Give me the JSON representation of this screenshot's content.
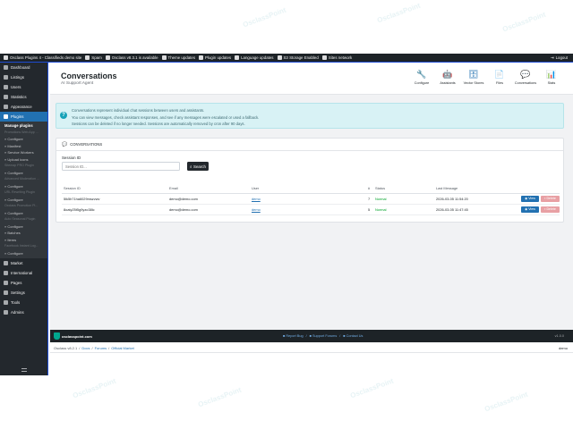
{
  "topbar": {
    "items": [
      "Osclass Plugins 4 - Classifieds demo site",
      "Spam",
      "Osclass v8.3.1 is available",
      "Theme updates",
      "Plugin updates",
      "Language updates",
      "S3 Storage Enabled",
      "Sites network"
    ],
    "logout": "Logout"
  },
  "sidebar": {
    "items_top": [
      "Dashboard",
      "Listings",
      "Users",
      "Statistics",
      "Appearance"
    ],
    "plugins": "Plugins",
    "sub": [
      {
        "t": "Manage plugins",
        "c": "head"
      },
      {
        "t": "Promotions Web App ...",
        "c": "grey"
      },
      {
        "t": "» Configure",
        "c": ""
      },
      {
        "t": "» Manifest",
        "c": ""
      },
      {
        "t": "» Service Workers",
        "c": ""
      },
      {
        "t": "» Upload icons",
        "c": ""
      },
      {
        "t": "Sitemap PRO Plugin",
        "c": "grey"
      },
      {
        "t": "» Configure",
        "c": ""
      },
      {
        "t": "Advanced Moderation ...",
        "c": "grey"
      },
      {
        "t": "» Configure",
        "c": ""
      },
      {
        "t": "URL Rewriting Plugin",
        "c": "grey"
      },
      {
        "t": "» Configure",
        "c": ""
      },
      {
        "t": "Oxclass Promotion Pl...",
        "c": "grey"
      },
      {
        "t": "» Configure",
        "c": ""
      },
      {
        "t": "Auto Seasonal Plugin",
        "c": "grey"
      },
      {
        "t": "» Configure",
        "c": ""
      },
      {
        "t": "» Batches",
        "c": ""
      },
      {
        "t": "» Items",
        "c": ""
      },
      {
        "t": "Facebook Instant Log...",
        "c": "grey"
      },
      {
        "t": "» Configure",
        "c": ""
      }
    ],
    "items_bottom": [
      "Market",
      "International",
      "Pages",
      "Settings",
      "Tools",
      "Admins"
    ]
  },
  "header": {
    "title": "Conversations",
    "subtitle": "AI Support Agent",
    "nav": [
      {
        "label": "Configure",
        "icon": "wrench-icon",
        "glyph": "🔧"
      },
      {
        "label": "Assistants",
        "icon": "android-icon",
        "glyph": "🤖"
      },
      {
        "label": "Vector Stores",
        "icon": "database-icon",
        "glyph": "🗄"
      },
      {
        "label": "Files",
        "icon": "file-icon",
        "glyph": "📄"
      },
      {
        "label": "Conversations",
        "icon": "comments-icon",
        "glyph": "💬"
      },
      {
        "label": "Stats",
        "icon": "chart-icon",
        "glyph": "📊"
      }
    ]
  },
  "info": {
    "lines": [
      "Conversations represent individual chat sessions between users and assistants.",
      "You can view messages, check assistant responses, and see if any messages were escalated or used a fallback.",
      "Sessions can be deleted if no longer needed. Sessions are automatically removed by cron after 90 days."
    ]
  },
  "card": {
    "title": "CONVERSATIONS",
    "session_label": "Session ID",
    "session_placeholder": "Session ID...",
    "search_label": "Search",
    "columns": [
      "Session ID",
      "Email",
      "User",
      "#",
      "Status",
      "Last Message",
      ""
    ],
    "rows": [
      {
        "session": "5lk5h71ha6029mszvwv",
        "email": "demo@demo.com",
        "user": "demo",
        "count": "7",
        "status": "Normal",
        "last": "2026-03-05 11:54:20",
        "view": "View",
        "delete": "Delete"
      },
      {
        "session": "8oaty25t5g9yzo38lc",
        "email": "demo@demo.com",
        "user": "demo",
        "count": "5",
        "status": "Normal",
        "last": "2026-03-05 11:47:45",
        "view": "View",
        "delete": "Delete"
      }
    ]
  },
  "footer": {
    "brand": "osclasspoint.com",
    "links": [
      "Report Bug",
      "Support Forums",
      "Contact Us"
    ],
    "version": "v1.0.0"
  },
  "bottombar": {
    "crumbs": [
      "Osclass v8.2.1",
      "Docs",
      "Forums",
      "Official Market"
    ],
    "user": "demo"
  }
}
